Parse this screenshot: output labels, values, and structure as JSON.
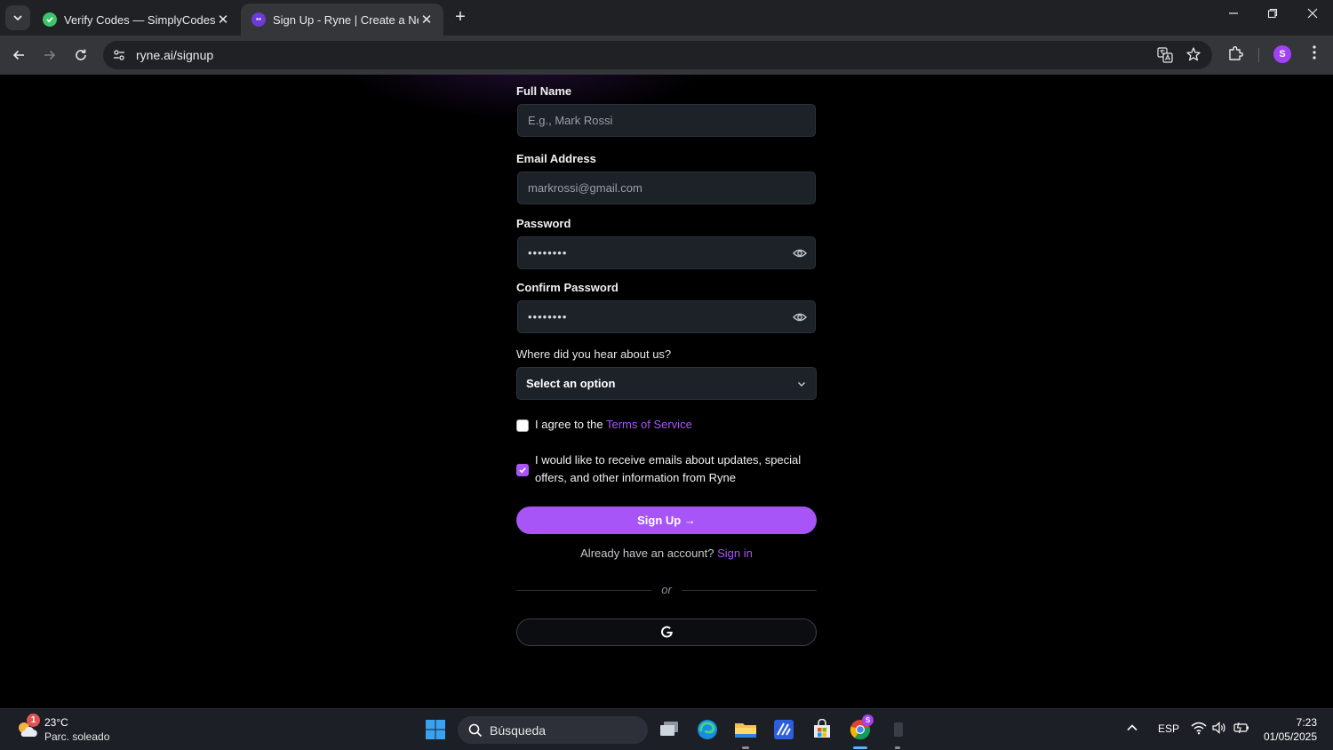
{
  "browser": {
    "tabs": [
      {
        "title": "Verify Codes — SimplyCodes",
        "active": false
      },
      {
        "title": "Sign Up - Ryne | Create a New Account",
        "active": true
      }
    ],
    "new_tab_label": "+",
    "url": "ryne.ai/signup",
    "profile_initial": "S"
  },
  "form": {
    "full_name": {
      "label": "Full Name",
      "placeholder": "E.g., Mark Rossi"
    },
    "email": {
      "label": "Email Address",
      "placeholder": "markrossi@gmail.com"
    },
    "password": {
      "label": "Password",
      "value": "••••••••"
    },
    "confirm_password": {
      "label": "Confirm Password",
      "value": "••••••••"
    },
    "referral": {
      "label": "Where did you hear about us?",
      "selected": "Select an option"
    },
    "terms": {
      "prefix": "I agree to the ",
      "link": "Terms of Service",
      "checked": false
    },
    "marketing": {
      "line1": "I would like to receive emails about updates, special",
      "line2": "offers, and other information from Ryne",
      "checked": true
    },
    "submit_label": "Sign Up →",
    "already_text": "Already have an account?",
    "sign_in_link": "Sign in",
    "divider_text": "or"
  },
  "colors": {
    "accent": "#a855f7",
    "field_bg": "#1d2128",
    "page_bg": "#000000"
  },
  "taskbar": {
    "weather": {
      "badge": "1",
      "temp": "23°C",
      "condition": "Parc. soleado"
    },
    "search_placeholder": "Búsqueda",
    "language": "ESP",
    "time": "7:23",
    "date": "01/05/2025",
    "chrome_badge": "S"
  }
}
